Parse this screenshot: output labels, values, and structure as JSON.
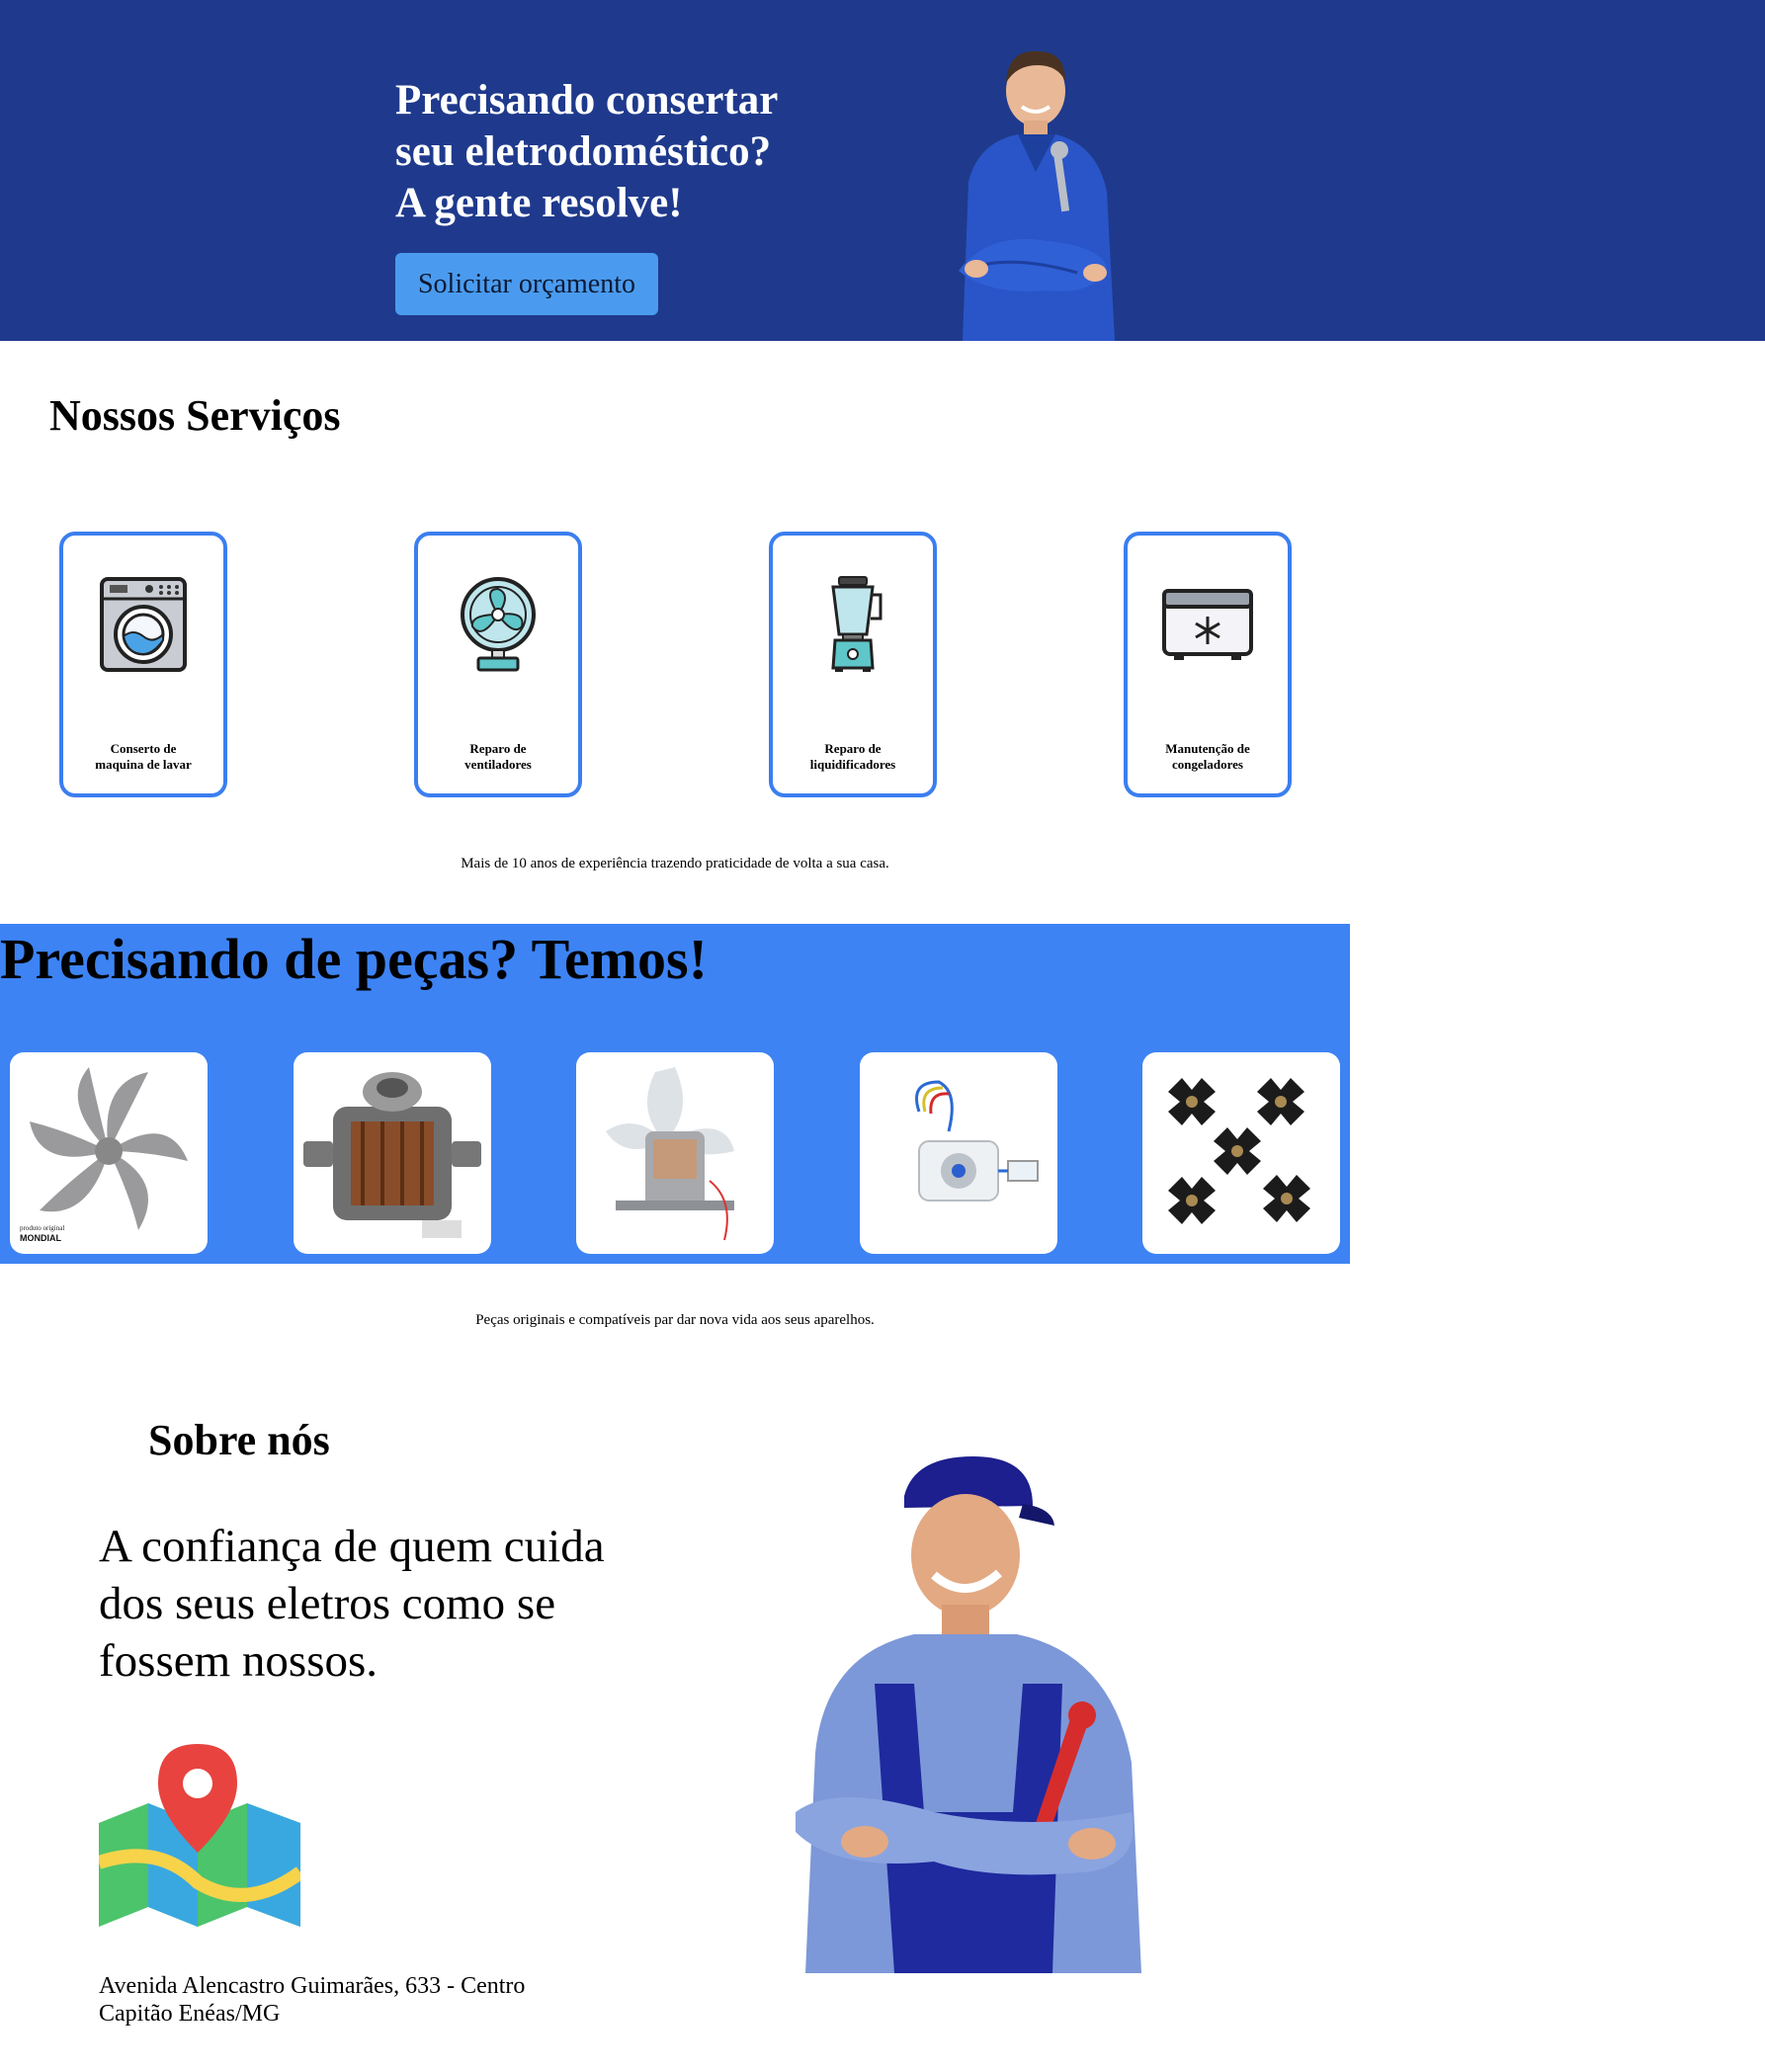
{
  "hero": {
    "title_lines": [
      "Precisando consertar",
      "seu eletrodoméstico?",
      "A gente resolve!"
    ],
    "cta_label": "Solicitar orçamento",
    "background_color": "#1f3a8c",
    "cta_color": "#4a9bef"
  },
  "services": {
    "title": "Nossos Serviços",
    "items": [
      {
        "line1": "Conserto de",
        "line2": "maquina de lavar",
        "icon": "washing-machine-icon"
      },
      {
        "line1": "Reparo de",
        "line2": "ventiladores",
        "icon": "fan-icon"
      },
      {
        "line1": "Reparo de",
        "line2": "liquidificadores",
        "icon": "blender-icon"
      },
      {
        "line1": "Manutenção de",
        "line2": "congeladores",
        "icon": "freezer-icon"
      }
    ],
    "tagline": "Mais de 10 anos de experiência trazendo praticidade de volta a sua casa.",
    "card_border_color": "#3b7ef0"
  },
  "parts": {
    "title": "Precisando de peças? Temos!",
    "background_color": "#3d83f4",
    "items": [
      {
        "icon": "fan-blade-image",
        "brand_line1": "produto original",
        "brand_line2": "MONDIAL"
      },
      {
        "icon": "washer-motor-image"
      },
      {
        "icon": "fan-motor-image"
      },
      {
        "icon": "refrigerator-fan-motor-image"
      },
      {
        "icon": "blender-couplings-image"
      }
    ],
    "tagline": "Peças originais e compatíveis par dar nova vida aos seus aparelhos."
  },
  "about": {
    "title": "Sobre nós",
    "quote_lines": [
      "A confiança de quem cuida",
      "dos seus eletros como se",
      "fossem nossos."
    ],
    "address_lines": [
      "Avenida Alencastro Guimarães, 633 - Centro",
      "Capitão Enéas/MG"
    ],
    "map_icon": "map-pin-icon"
  }
}
